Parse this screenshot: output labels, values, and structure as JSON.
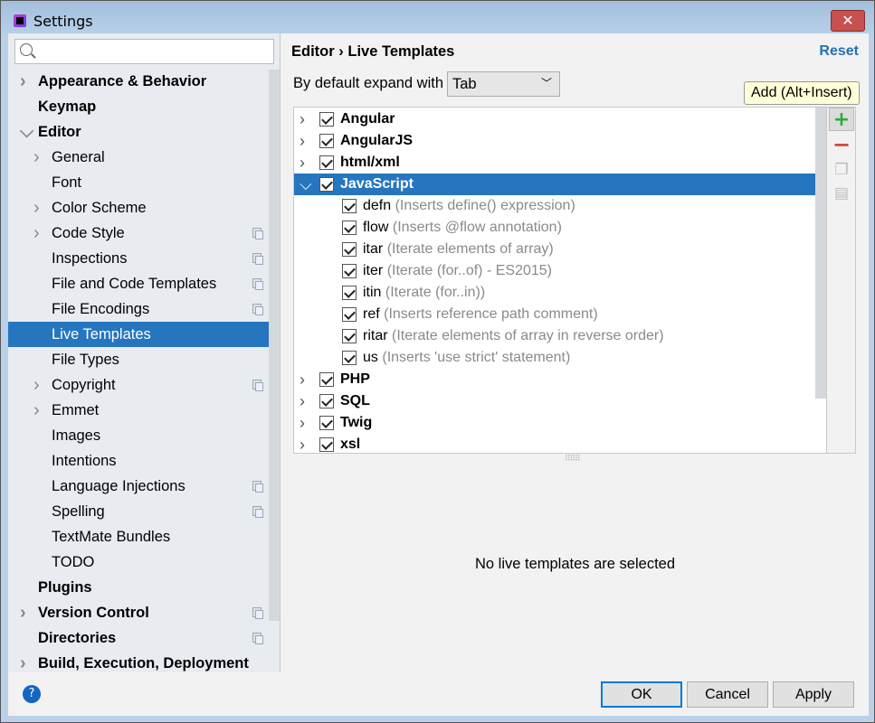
{
  "window": {
    "title": "Settings",
    "close_label": "✕"
  },
  "search": {
    "placeholder": ""
  },
  "sidebar": {
    "items": [
      {
        "label": "Appearance & Behavior",
        "level": 0,
        "bold": true,
        "arrow": "right"
      },
      {
        "label": "Keymap",
        "level": 0,
        "bold": true
      },
      {
        "label": "Editor",
        "level": 0,
        "bold": true,
        "arrow": "down"
      },
      {
        "label": "General",
        "level": 1,
        "arrow": "right"
      },
      {
        "label": "Font",
        "level": 1
      },
      {
        "label": "Color Scheme",
        "level": 1,
        "arrow": "right"
      },
      {
        "label": "Code Style",
        "level": 1,
        "arrow": "right",
        "copy": true
      },
      {
        "label": "Inspections",
        "level": 1,
        "copy": true
      },
      {
        "label": "File and Code Templates",
        "level": 1,
        "copy": true
      },
      {
        "label": "File Encodings",
        "level": 1,
        "copy": true
      },
      {
        "label": "Live Templates",
        "level": 1,
        "selected": true
      },
      {
        "label": "File Types",
        "level": 1
      },
      {
        "label": "Copyright",
        "level": 1,
        "arrow": "right",
        "copy": true
      },
      {
        "label": "Emmet",
        "level": 1,
        "arrow": "right"
      },
      {
        "label": "Images",
        "level": 1
      },
      {
        "label": "Intentions",
        "level": 1
      },
      {
        "label": "Language Injections",
        "level": 1,
        "copy": true
      },
      {
        "label": "Spelling",
        "level": 1,
        "copy": true
      },
      {
        "label": "TextMate Bundles",
        "level": 1
      },
      {
        "label": "TODO",
        "level": 1
      },
      {
        "label": "Plugins",
        "level": 0,
        "bold": true
      },
      {
        "label": "Version Control",
        "level": 0,
        "bold": true,
        "arrow": "right",
        "copy": true
      },
      {
        "label": "Directories",
        "level": 0,
        "bold": true,
        "copy": true
      },
      {
        "label": "Build, Execution, Deployment",
        "level": 0,
        "bold": true,
        "arrow": "right"
      }
    ]
  },
  "main": {
    "breadcrumb": {
      "parent": "Editor",
      "separator": "›",
      "current": "Live Templates"
    },
    "reset_label": "Reset",
    "expand_label": "By default expand with",
    "expand_value": "Tab",
    "tooltip": "Add (Alt+Insert)",
    "tree": [
      {
        "name": "Angular",
        "group": true,
        "expanded": false,
        "checked": true
      },
      {
        "name": "AngularJS",
        "group": true,
        "expanded": false,
        "checked": true
      },
      {
        "name": "html/xml",
        "group": true,
        "expanded": false,
        "checked": true
      },
      {
        "name": "JavaScript",
        "group": true,
        "expanded": true,
        "checked": true,
        "selected": true
      },
      {
        "name": "defn",
        "desc": "(Inserts define() expression)",
        "checked": true
      },
      {
        "name": "flow",
        "desc": "(Inserts @flow annotation)",
        "checked": true
      },
      {
        "name": "itar",
        "desc": "(Iterate elements of array)",
        "checked": true
      },
      {
        "name": "iter",
        "desc": "(Iterate (for..of) - ES2015)",
        "checked": true
      },
      {
        "name": "itin",
        "desc": "(Iterate (for..in))",
        "checked": true
      },
      {
        "name": "ref",
        "desc": "(Inserts reference path comment)",
        "checked": true
      },
      {
        "name": "ritar",
        "desc": "(Iterate elements of array in reverse order)",
        "checked": true
      },
      {
        "name": "us",
        "desc": "(Inserts 'use strict' statement)",
        "checked": true
      },
      {
        "name": "PHP",
        "group": true,
        "expanded": false,
        "checked": true
      },
      {
        "name": "SQL",
        "group": true,
        "expanded": false,
        "checked": true
      },
      {
        "name": "Twig",
        "group": true,
        "expanded": false,
        "checked": true
      },
      {
        "name": "xsl",
        "group": true,
        "expanded": false,
        "checked": true
      }
    ],
    "empty_text": "No live templates are selected"
  },
  "footer": {
    "help": "?",
    "ok": "OK",
    "cancel": "Cancel",
    "apply": "Apply"
  },
  "colors": {
    "selection": "#2675bf",
    "add": "#2eaa3a",
    "remove": "#d04a3a",
    "link": "#2470b3"
  }
}
